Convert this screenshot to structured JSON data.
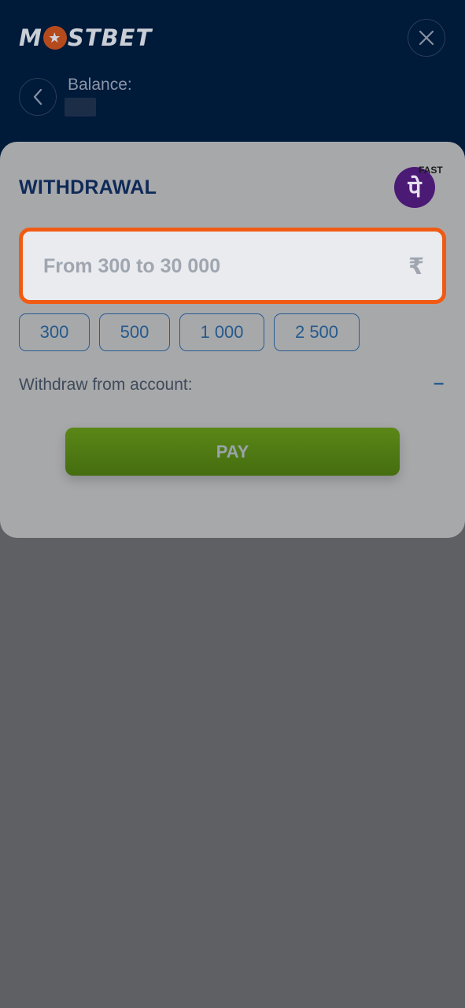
{
  "header": {
    "logo_left": "M",
    "logo_star": "★",
    "logo_right": "STBET",
    "balance_label": "Balance:"
  },
  "icons": {
    "close": "close-icon",
    "back": "chevron-left-icon"
  },
  "withdrawal": {
    "title": "WITHDRAWAL",
    "method_logo_glyph": "पे",
    "method_badge": "FAST",
    "amount_placeholder": "From 300 to 30 000",
    "currency_symbol": "₹",
    "quick_amounts": [
      "300",
      "500",
      "1 000",
      "2 500"
    ],
    "withdraw_from_label": "Withdraw from account:",
    "withdraw_from_value": "–",
    "pay_label": "PAY"
  },
  "colors": {
    "header_bg": "#001a3a",
    "accent_orange": "#f15a13",
    "pay_green": "#4f7b14",
    "link_blue": "#255a8e"
  }
}
